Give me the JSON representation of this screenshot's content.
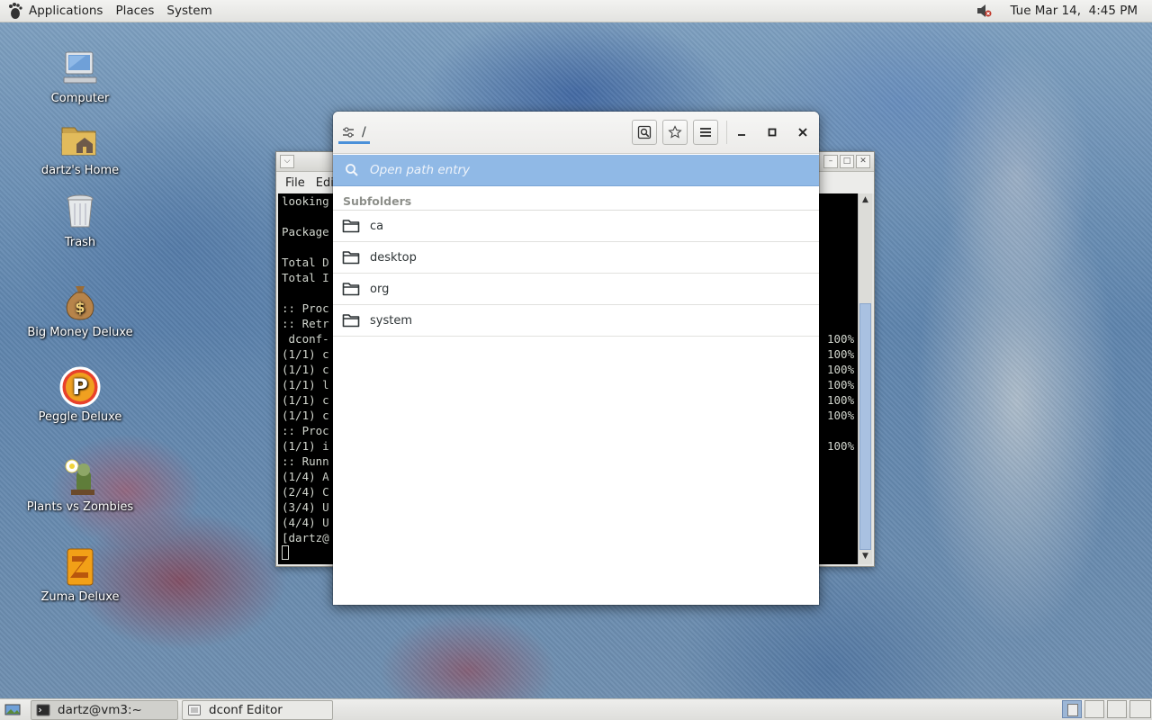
{
  "top_panel": {
    "menus": [
      "Applications",
      "Places",
      "System"
    ],
    "clock": "Tue Mar 14,  4:45 PM"
  },
  "desktop_icons": [
    {
      "label": "Computer",
      "icon": "computer-icon"
    },
    {
      "label": "dartz's Home",
      "icon": "home-folder-icon"
    },
    {
      "label": "Trash",
      "icon": "trash-icon"
    },
    {
      "label": "Big Money Deluxe",
      "icon": "money-bag-icon"
    },
    {
      "label": "Peggle Deluxe",
      "icon": "peggle-icon"
    },
    {
      "label": "Plants vs Zombies",
      "icon": "plants-vs-zombies-icon"
    },
    {
      "label": "Zuma Deluxe",
      "icon": "zuma-icon"
    }
  ],
  "terminal": {
    "menu": [
      "File",
      "Edi"
    ],
    "lines": [
      {
        "text": "looking"
      },
      {
        "text": ""
      },
      {
        "text": "Package"
      },
      {
        "text": ""
      },
      {
        "text": "Total D"
      },
      {
        "text": "Total I"
      },
      {
        "text": ""
      },
      {
        "text": ":: Proc"
      },
      {
        "text": ":: Retr"
      },
      {
        "text": " dconf-",
        "pct": "100%"
      },
      {
        "text": "(1/1) c",
        "pct": "100%"
      },
      {
        "text": "(1/1) c",
        "pct": "100%"
      },
      {
        "text": "(1/1) l",
        "pct": "100%"
      },
      {
        "text": "(1/1) c",
        "pct": "100%"
      },
      {
        "text": "(1/1) c",
        "pct": "100%"
      },
      {
        "text": ":: Proc"
      },
      {
        "text": "(1/1) i",
        "pct": "100%"
      },
      {
        "text": ":: Runn"
      },
      {
        "text": "(1/4) A"
      },
      {
        "text": "(2/4) C"
      },
      {
        "text": "(3/4) U"
      },
      {
        "text": "(4/4) U"
      },
      {
        "text": "[dartz@"
      }
    ]
  },
  "dconf": {
    "path": "/",
    "search_placeholder": "Open path entry",
    "section_title": "Subfolders",
    "folders": [
      "ca",
      "desktop",
      "org",
      "system"
    ]
  },
  "taskbar": {
    "tasks": [
      {
        "label": "dartz@vm3:~",
        "icon": "terminal-icon",
        "active": true
      },
      {
        "label": "dconf Editor",
        "icon": "dconf-icon",
        "active": false
      }
    ]
  },
  "colors": {
    "accent": "#4a90d9",
    "search_bar": "#90b9e6"
  }
}
